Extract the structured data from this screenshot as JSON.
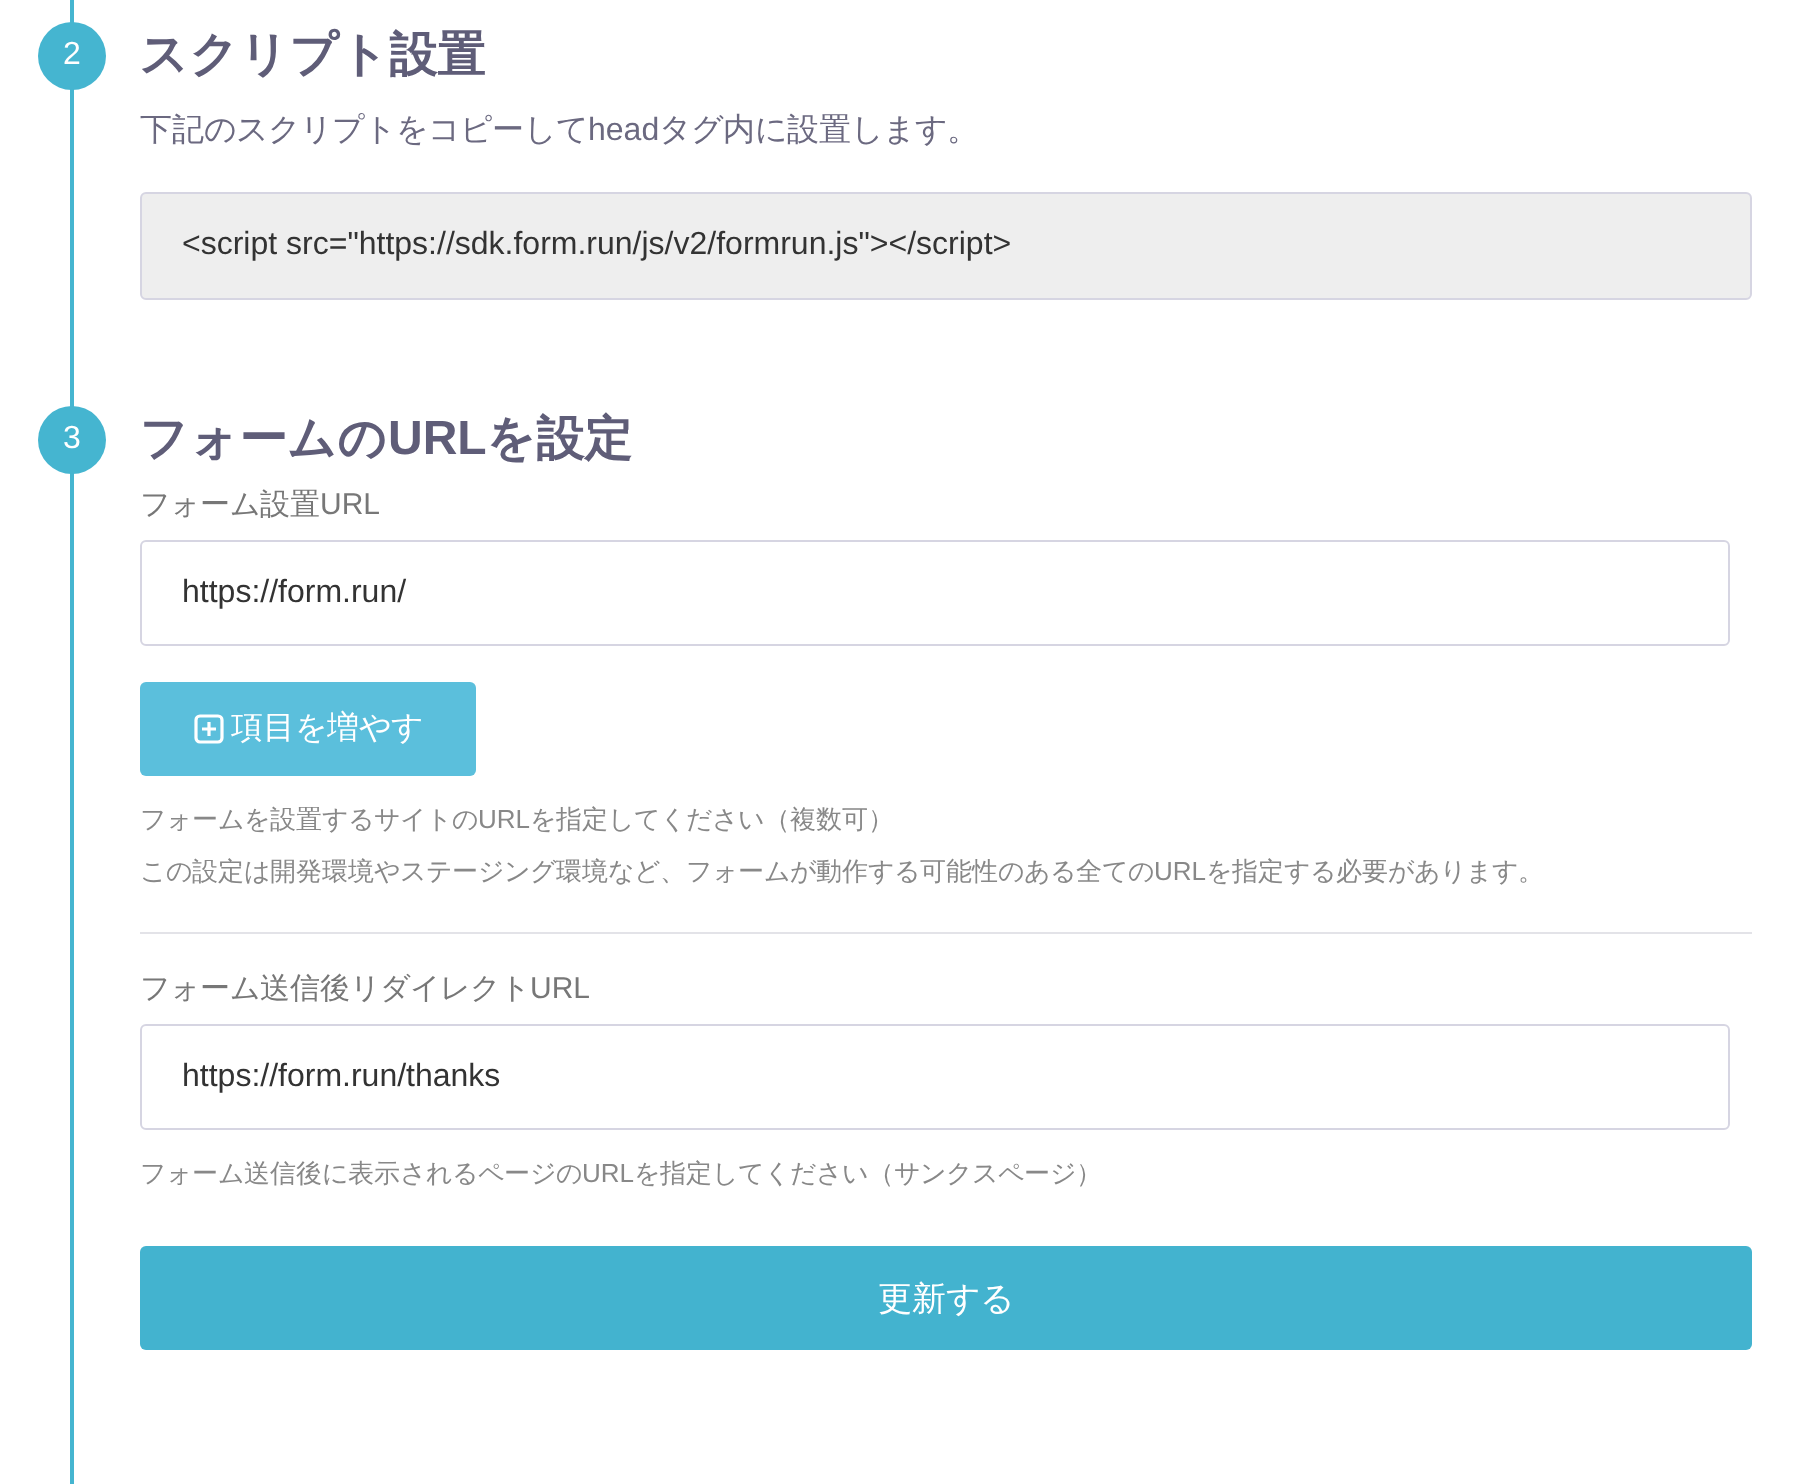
{
  "steps": [
    {
      "number": "2",
      "title": "スクリプト設置",
      "description": "下記のスクリプトをコピーしてheadタグ内に設置します。",
      "code": "<script src=\"https://sdk.form.run/js/v2/formrun.js\"></script>"
    },
    {
      "number": "3",
      "title": "フォームのURLを設定",
      "sections": [
        {
          "label": "フォーム設置URL",
          "value": "https://form.run/",
          "add_button": "項目を増やす",
          "help": [
            "フォームを設置するサイトのURLを指定してください（複数可）",
            "この設定は開発環境やステージング環境など、フォームが動作する可能性のある全てのURLを指定する必要があります。"
          ]
        },
        {
          "label": "フォーム送信後リダイレクトURL",
          "value": "https://form.run/thanks",
          "help": [
            "フォーム送信後に表示されるページのURLを指定してください（サンクスページ）"
          ]
        }
      ],
      "submit": "更新する"
    }
  ]
}
